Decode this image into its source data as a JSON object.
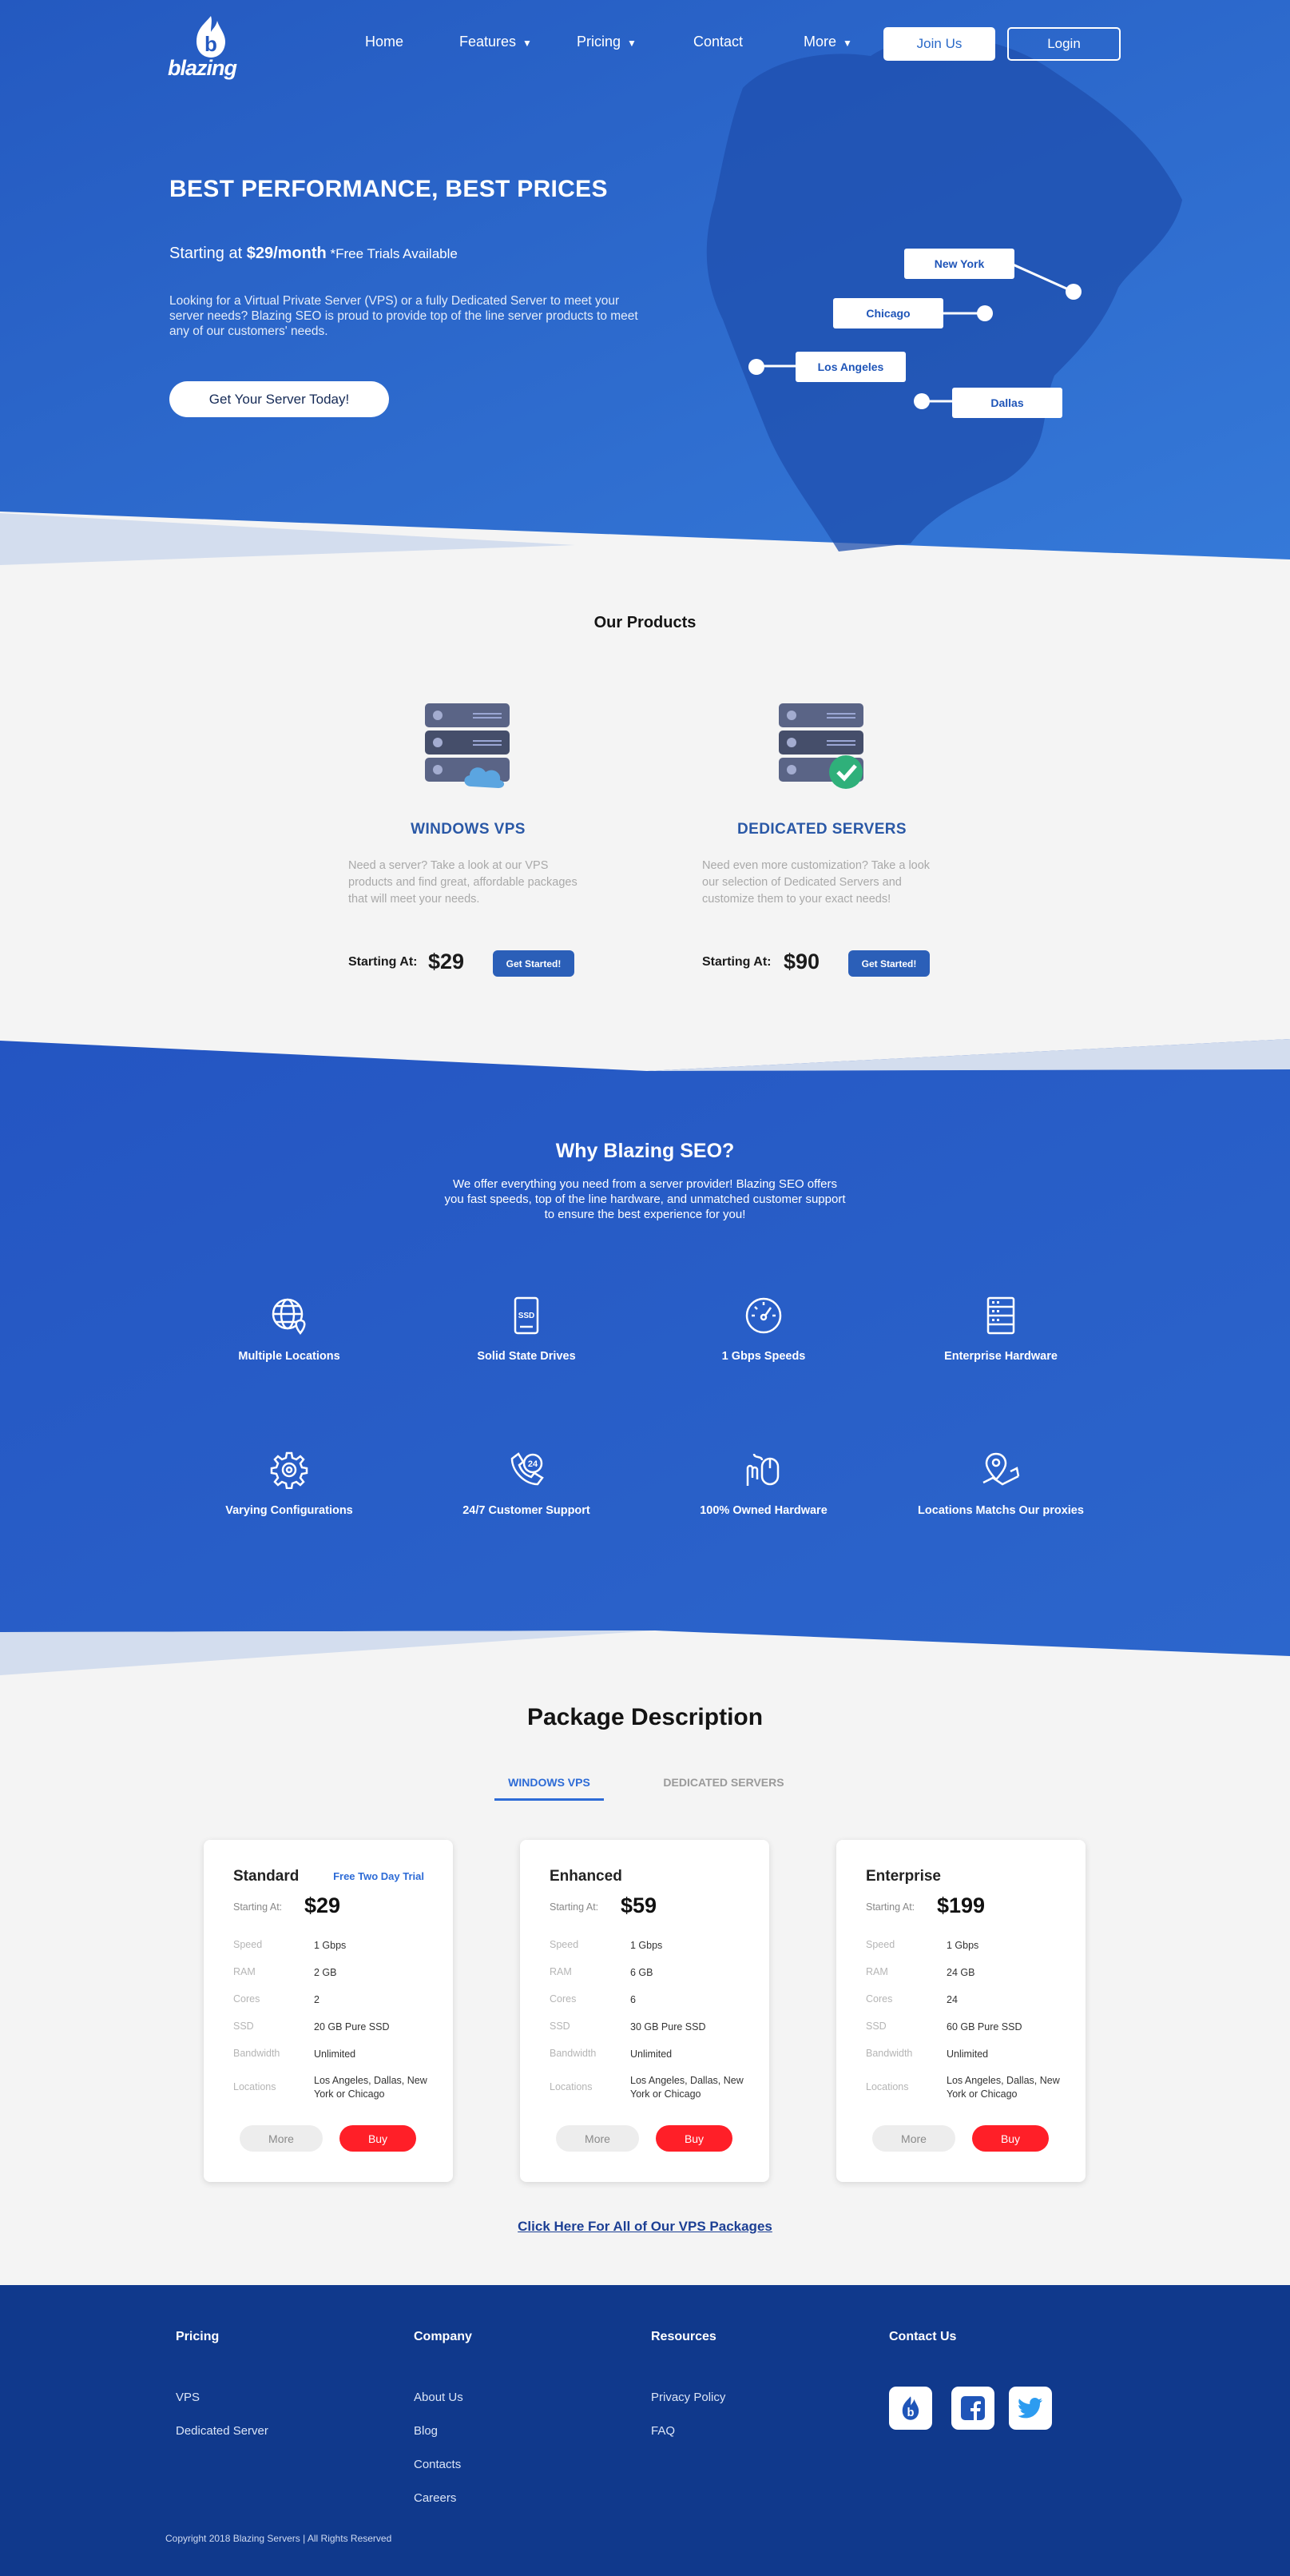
{
  "brand": {
    "name": "blazing",
    "logo_icon": "flame-b-logo"
  },
  "nav": {
    "items": [
      {
        "label": "Home"
      },
      {
        "label": "Features",
        "dropdown": true
      },
      {
        "label": "Pricing",
        "dropdown": true
      },
      {
        "label": "Contact"
      },
      {
        "label": "More",
        "dropdown": true
      }
    ],
    "join": "Join Us",
    "login": "Login"
  },
  "hero": {
    "title": "BEST PERFORMANCE, BEST PRICES",
    "starting_prefix": "Starting at ",
    "starting_price": "$29/month",
    "trial": " *Free Trials Available",
    "description": "Looking for a Virtual Private Server (VPS) or a fully Dedicated Server to meet your server needs? Blazing SEO is proud to provide top of the line server products to meet any of our customers' needs.",
    "cta": "Get Your Server Today!",
    "cities": [
      "New York",
      "Chicago",
      "Los Angeles",
      "Dallas"
    ]
  },
  "products": {
    "title": "Our Products",
    "items": [
      {
        "name": "WINDOWS VPS",
        "icon": "server-cloud-icon",
        "description": "Need a server? Take a look at our VPS products and find great, affordable packages that will meet your needs.",
        "starting_label": "Starting At:",
        "price": "$29",
        "button": "Get Started!"
      },
      {
        "name": "DEDICATED SERVERS",
        "icon": "server-check-icon",
        "description": "Need even more customization? Take a look our selection of Dedicated Servers and customize them to your exact needs!",
        "starting_label": "Starting At:",
        "price": "$90",
        "button": "Get Started!"
      }
    ]
  },
  "why": {
    "title": "Why Blazing SEO?",
    "description": "We offer everything you need from a server provider! Blazing SEO offers you fast speeds, top of the line hardware, and unmatched customer support to ensure the best experience for you!",
    "features": [
      {
        "label": "Multiple Locations",
        "icon": "globe-pin-icon"
      },
      {
        "label": "Solid State Drives",
        "icon": "ssd-icon"
      },
      {
        "label": "1 Gbps Speeds",
        "icon": "speedometer-icon"
      },
      {
        "label": "Enterprise Hardware",
        "icon": "server-rack-icon"
      },
      {
        "label": "Varying Configurations",
        "icon": "gear-icon"
      },
      {
        "label": "24/7 Customer Support",
        "icon": "support-24-icon"
      },
      {
        "label": "100% Owned Hardware",
        "icon": "hand-mouse-icon"
      },
      {
        "label": "Locations Matchs Our proxies",
        "icon": "map-pin-icon"
      }
    ],
    "ssd_text": "SSD",
    "support_num": "24"
  },
  "packages": {
    "title": "Package Description",
    "tabs": [
      {
        "label": "WINDOWS VPS",
        "active": true
      },
      {
        "label": "DEDICATED SERVERS",
        "active": false
      }
    ],
    "spec_labels": [
      "Speed",
      "RAM",
      "Cores",
      "SSD",
      "Bandwidth",
      "Locations"
    ],
    "cards": [
      {
        "name": "Standard",
        "badge": "Free Two Day Trial",
        "starting_label": "Starting At:",
        "price": "$29",
        "specs": [
          "1 Gbps",
          "2 GB",
          "2",
          "20 GB Pure SSD",
          "Unlimited",
          "Los Angeles, Dallas, New York or Chicago"
        ],
        "more": "More",
        "buy": "Buy"
      },
      {
        "name": "Enhanced",
        "badge": "",
        "starting_label": "Starting At:",
        "price": "$59",
        "specs": [
          "1 Gbps",
          "6 GB",
          "6",
          "30 GB Pure SSD",
          "Unlimited",
          "Los Angeles, Dallas, New York or Chicago"
        ],
        "more": "More",
        "buy": "Buy"
      },
      {
        "name": "Enterprise",
        "badge": "",
        "starting_label": "Starting At:",
        "price": "$199",
        "specs": [
          "1 Gbps",
          "24 GB",
          "24",
          "60 GB Pure SSD",
          "Unlimited",
          "Los Angeles, Dallas, New York or Chicago"
        ],
        "more": "More",
        "buy": "Buy"
      }
    ],
    "all_link": "Click Here For All of Our VPS Packages"
  },
  "footer": {
    "columns": [
      {
        "title": "Pricing",
        "links": [
          "VPS",
          "Dedicated Server"
        ]
      },
      {
        "title": "Company",
        "links": [
          "About Us",
          "Blog",
          "Contacts",
          "Careers"
        ]
      },
      {
        "title": "Resources",
        "links": [
          "Privacy Policy",
          "FAQ"
        ]
      },
      {
        "title": "Contact Us",
        "links": []
      }
    ],
    "social": [
      "blazing-logo-icon",
      "facebook-icon",
      "twitter-icon"
    ],
    "copyright": "Copyright 2018 Blazing Servers | All Rights Reserved"
  },
  "colors": {
    "primary": "#2b62c9",
    "navy": "#10398c",
    "buy_red": "#ff1f28",
    "accent_blue": "#2d6bd6",
    "bg_light": "#f4f4f4"
  }
}
